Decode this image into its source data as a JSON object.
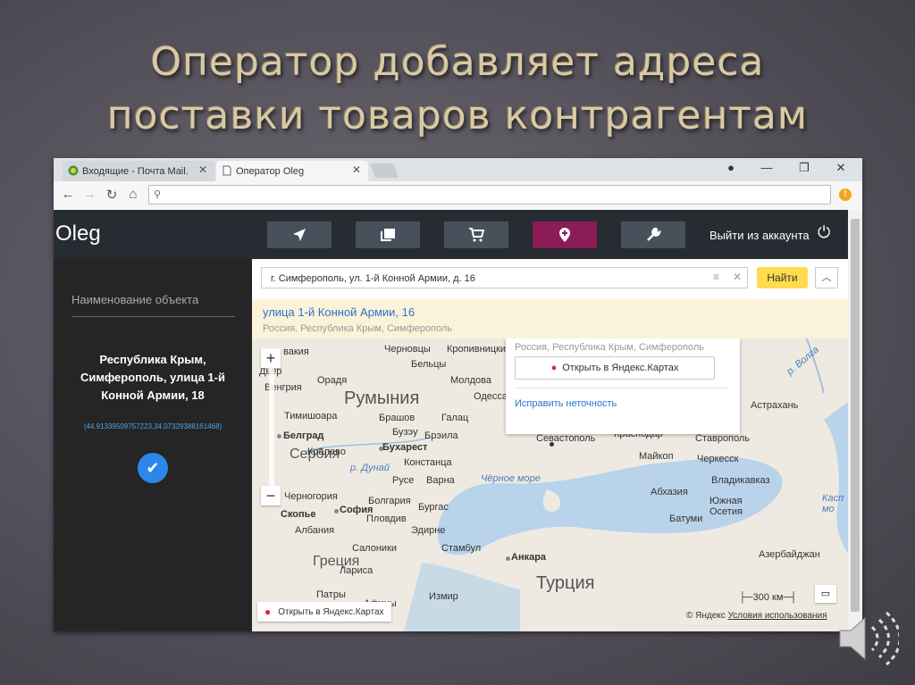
{
  "slide": {
    "title_line1": "Оператор добавляет адреса",
    "title_line2": "поставки товаров контрагентам"
  },
  "browser": {
    "tabs": [
      {
        "label": "Входящие - Почта Mail.",
        "icon": "mail-globe-icon"
      },
      {
        "label": "Оператор Oleg",
        "icon": "page-icon"
      }
    ],
    "address_value": ""
  },
  "app": {
    "logo": "Oleg",
    "nav": [
      {
        "icon": "navigation-arrow-icon"
      },
      {
        "icon": "catalog-icon"
      },
      {
        "icon": "cart-icon"
      },
      {
        "icon": "location-pin-icon",
        "active": true
      },
      {
        "icon": "wrench-icon"
      }
    ],
    "logout_label": "Выйти из аккаунта",
    "accent_color": "#8c1c55"
  },
  "sidebar": {
    "field_label": "Наименование объекта",
    "address": "Республика Крым, Симферополь, улица 1-й Конной Армии, 18",
    "coordinates": "(44.91339509757223,34.07329388161468)"
  },
  "map": {
    "search_value": "г. Симферополь, ул. 1-й Конной Армии, д. 16",
    "find_label": "Найти",
    "suggestion_title": "улица 1-й Конной Армии, 16",
    "suggestion_subtitle": "Россия, Республика Крым, Симферополь",
    "balloon": {
      "subtitle": "Россия, Республика Крым, Симферополь",
      "open_label": "Открыть в Яндекс.Картах",
      "fix_label": "Исправить неточность"
    },
    "labels": {
      "romania": "Румыния",
      "serbia": "Сербия",
      "greece": "Греция",
      "turkey": "Турция",
      "black_sea": "Чёрное море",
      "hungary": "Венгрия",
      "moldova": "Молдова",
      "bulgaria": "Болгария",
      "abkhazia": "Абхазия",
      "south_ossetia": "Южная Осетия",
      "azerbaijan": "Азербайджан",
      "albania": "Албания",
      "slovakia": "вакия",
      "dor": "Дьёр",
      "oradea": "Орадя",
      "chernovtsy": "Черновцы",
      "kropyvnytskyi": "Кропивницкий",
      "balti": "Бельцы",
      "odessa": "Одесса",
      "timisoara": "Тимишоара",
      "brasov": "Брашов",
      "belgrade": "Белград",
      "bucharest": "Бухарест",
      "buzau": "Бузэу",
      "braila": "Брэила",
      "galati": "Галац",
      "kraljevo": "Кралево",
      "danube": "р. Дунай",
      "constanta": "Констанца",
      "ruse": "Русе",
      "varna": "Варна",
      "montenegro": "Черногория",
      "skopje": "Скопье",
      "sofia": "София",
      "plovdiv": "Пловдив",
      "burgas": "Бургас",
      "sevastopol": "Севастополь",
      "krasnodar": "Краснодар",
      "maykop": "Майкоп",
      "stavropol": "Ставрополь",
      "cherkessk": "Черкесск",
      "vladikavkaz": "Владикавказ",
      "astrakhan": "Астрахань",
      "volga": "р. Волга",
      "batumi": "Батуми",
      "caspian": "Касп мо",
      "ankara": "Анкара",
      "thessaloniki": "Салоники",
      "larisa": "Лариса",
      "patras": "Патры",
      "athens": "Афины",
      "izmir": "Измир",
      "edirne": "Эдирне",
      "istanbul": "Стамбул"
    },
    "scale_label": "300 км",
    "open_map_label": "Открыть в Яндекс.Картах",
    "copyright": "© Яндекс",
    "terms_label": "Условия использования"
  }
}
